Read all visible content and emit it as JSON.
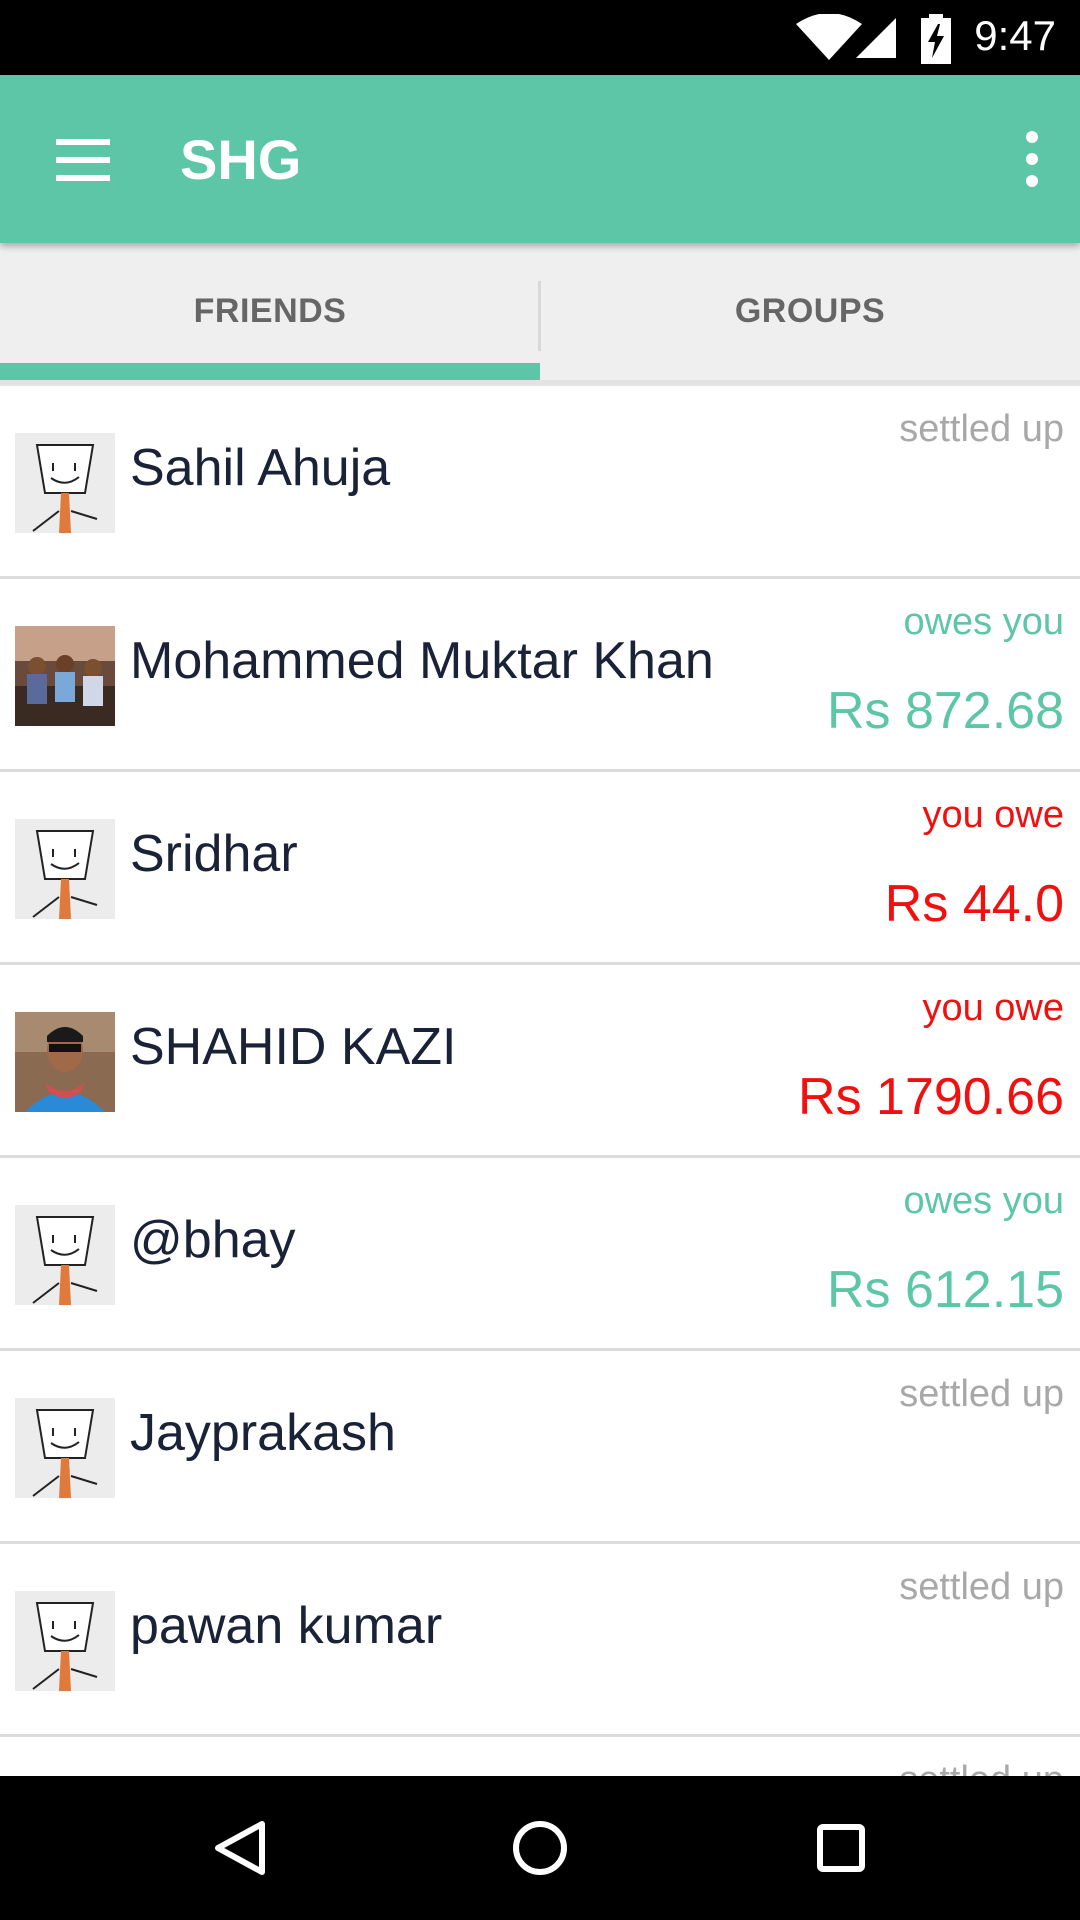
{
  "status_bar": {
    "time": "9:47",
    "icons": [
      "wifi-icon",
      "cell-signal-icon",
      "battery-charging-icon"
    ]
  },
  "app_bar": {
    "title": "SHG",
    "left_icon": "menu-icon",
    "right_icon": "overflow-menu-icon",
    "color": "#5DC6A6"
  },
  "tabs": [
    {
      "label": "FRIENDS",
      "selected": true
    },
    {
      "label": "GROUPS",
      "selected": false
    }
  ],
  "colors": {
    "accent": "#5DC6A6",
    "owes_you": "#5DC6A6",
    "you_owe": "#F01010",
    "settled": "#A8A8A8",
    "name": "#1A2238"
  },
  "friends": [
    {
      "name": "Sahil Ahuja",
      "status": "settled up",
      "amount": "",
      "avatar": "default-avatar"
    },
    {
      "name": "Mohammed Muktar Khan",
      "status": "owes you",
      "amount": "Rs 872.68",
      "avatar": "group-photo"
    },
    {
      "name": "Sridhar",
      "status": "you owe",
      "amount": "Rs 44.0",
      "avatar": "default-avatar"
    },
    {
      "name": "SHAHID KAZI",
      "status": "you owe",
      "amount": "Rs 1790.66",
      "avatar": "person-photo"
    },
    {
      "name": "@bhay",
      "status": "owes you",
      "amount": "Rs 612.15",
      "avatar": "default-avatar"
    },
    {
      "name": "Jayprakash",
      "status": "settled up",
      "amount": "",
      "avatar": "default-avatar"
    },
    {
      "name": "pawan kumar",
      "status": "settled up",
      "amount": "",
      "avatar": "default-avatar"
    },
    {
      "name": "",
      "status": "settled up",
      "amount": "",
      "avatar": "default-avatar"
    }
  ],
  "nav_bar": {
    "buttons": [
      "back-icon",
      "home-icon",
      "recents-icon"
    ]
  }
}
